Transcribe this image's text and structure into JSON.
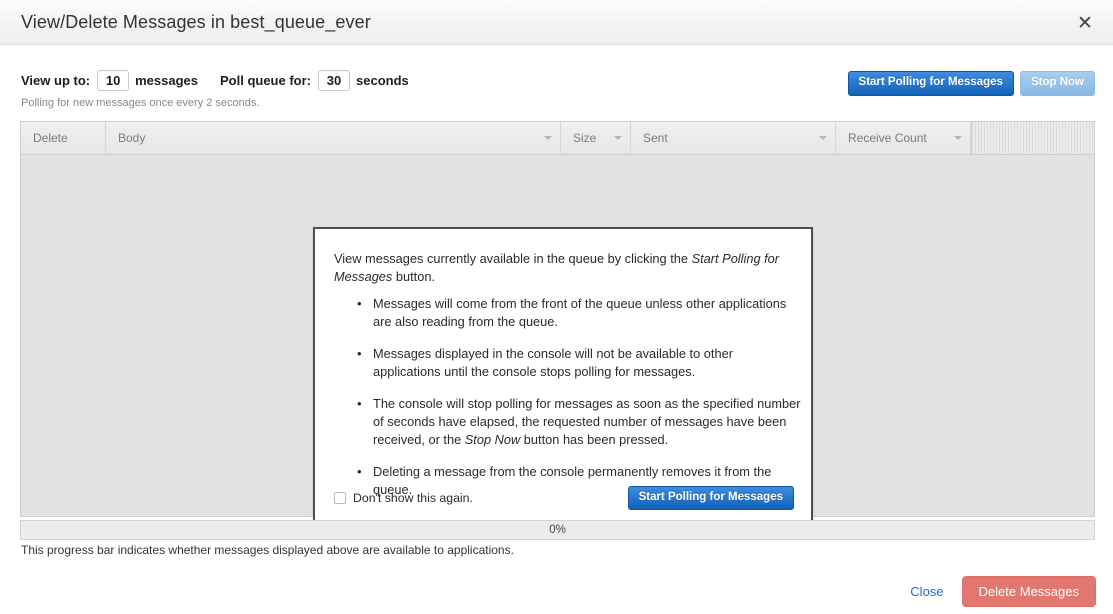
{
  "titlebar": {
    "title": "View/Delete Messages in best_queue_ever",
    "close_icon": "close-icon",
    "close_glyph": "✕"
  },
  "controls": {
    "view_up_to_label": "View up to:",
    "view_up_to_value": "10",
    "messages_unit": "messages",
    "poll_queue_label": "Poll queue for:",
    "poll_queue_value": "30",
    "seconds_unit": "seconds",
    "hint": "Polling for new messages once every 2 seconds.",
    "start_polling_label": "Start Polling for Messages",
    "stop_now_label": "Stop Now"
  },
  "table": {
    "columns": [
      {
        "label": "Delete",
        "sortable": false
      },
      {
        "label": "Body",
        "sortable": true
      },
      {
        "label": "Size",
        "sortable": true
      },
      {
        "label": "Sent",
        "sortable": true
      },
      {
        "label": "Receive Count",
        "sortable": true
      }
    ],
    "rows": []
  },
  "info_panel": {
    "intro_prefix": "View messages currently available in the queue by clicking the ",
    "intro_emphasis": "Start Polling for Messages",
    "intro_suffix": " button.",
    "bullets": [
      {
        "text": "Messages will come from the front of the queue unless other applications are also reading from the queue."
      },
      {
        "text": "Messages displayed in the console will not be available to other applications until the console stops polling for messages."
      },
      {
        "prefix": "The console will stop polling for messages as soon as the specified number of seconds have elapsed, the requested number of messages have been received, or the ",
        "emphasis": "Stop Now",
        "suffix": " button has been pressed."
      },
      {
        "text": "Deleting a message from the console permanently removes it from the queue."
      }
    ],
    "dont_show_label": "Don't show this again.",
    "start_polling_label": "Start Polling for Messages"
  },
  "progress": {
    "value_label": "0%",
    "percent": 0,
    "caption": "This progress bar indicates whether messages displayed above are available to applications."
  },
  "footer": {
    "close_label": "Close",
    "delete_label": "Delete Messages"
  },
  "colors": {
    "accent_blue": "#1461b8",
    "disabled_blue": "#a9cdee",
    "danger_red": "#e2776f",
    "link_blue": "#1f6bc4",
    "table_body": "#e2e2e2"
  }
}
